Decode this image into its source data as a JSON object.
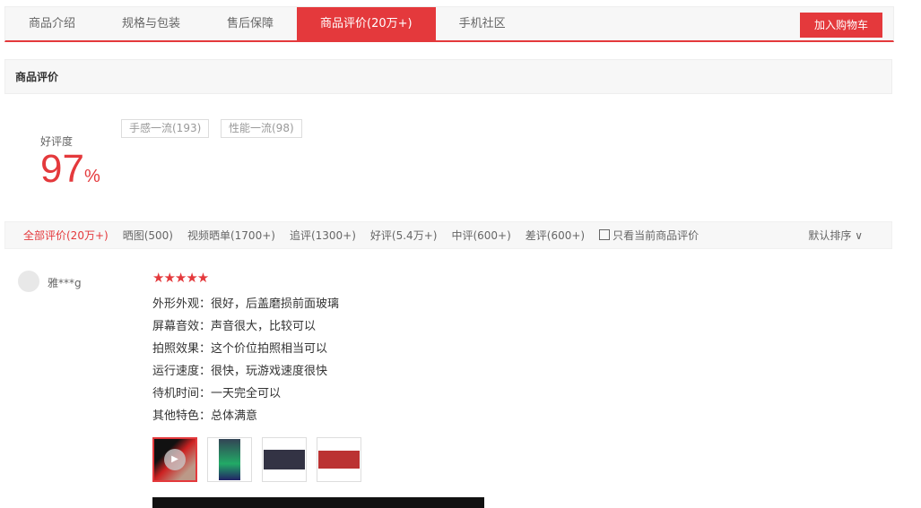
{
  "tabs": [
    "商品介绍",
    "规格与包装",
    "售后保障",
    "商品评价(20万+)",
    "手机社区"
  ],
  "cart_label": "加入购物车",
  "section_title": "商品评价",
  "rating": {
    "label": "好评度",
    "value": "97",
    "unit": "%"
  },
  "tags": [
    "手感一流(193)",
    "性能一流(98)"
  ],
  "filters": [
    "全部评价(20万+)",
    "晒图(500)",
    "视频晒单(1700+)",
    "追评(1300+)",
    "好评(5.4万+)",
    "中评(600+)",
    "差评(600+)"
  ],
  "only_current": "只看当前商品评价",
  "sort": "默认排序",
  "review": {
    "user": "雅***g",
    "stars": 5,
    "lines": [
      "外形外观：很好，后盖磨损前面玻璃",
      "屏幕音效：声音很大，比较可以",
      "拍照效果：这个价位拍照相当可以",
      "运行速度：很快，玩游戏速度很快",
      "待机时间：一天完全可以",
      "其他特色：总体满意"
    ]
  }
}
